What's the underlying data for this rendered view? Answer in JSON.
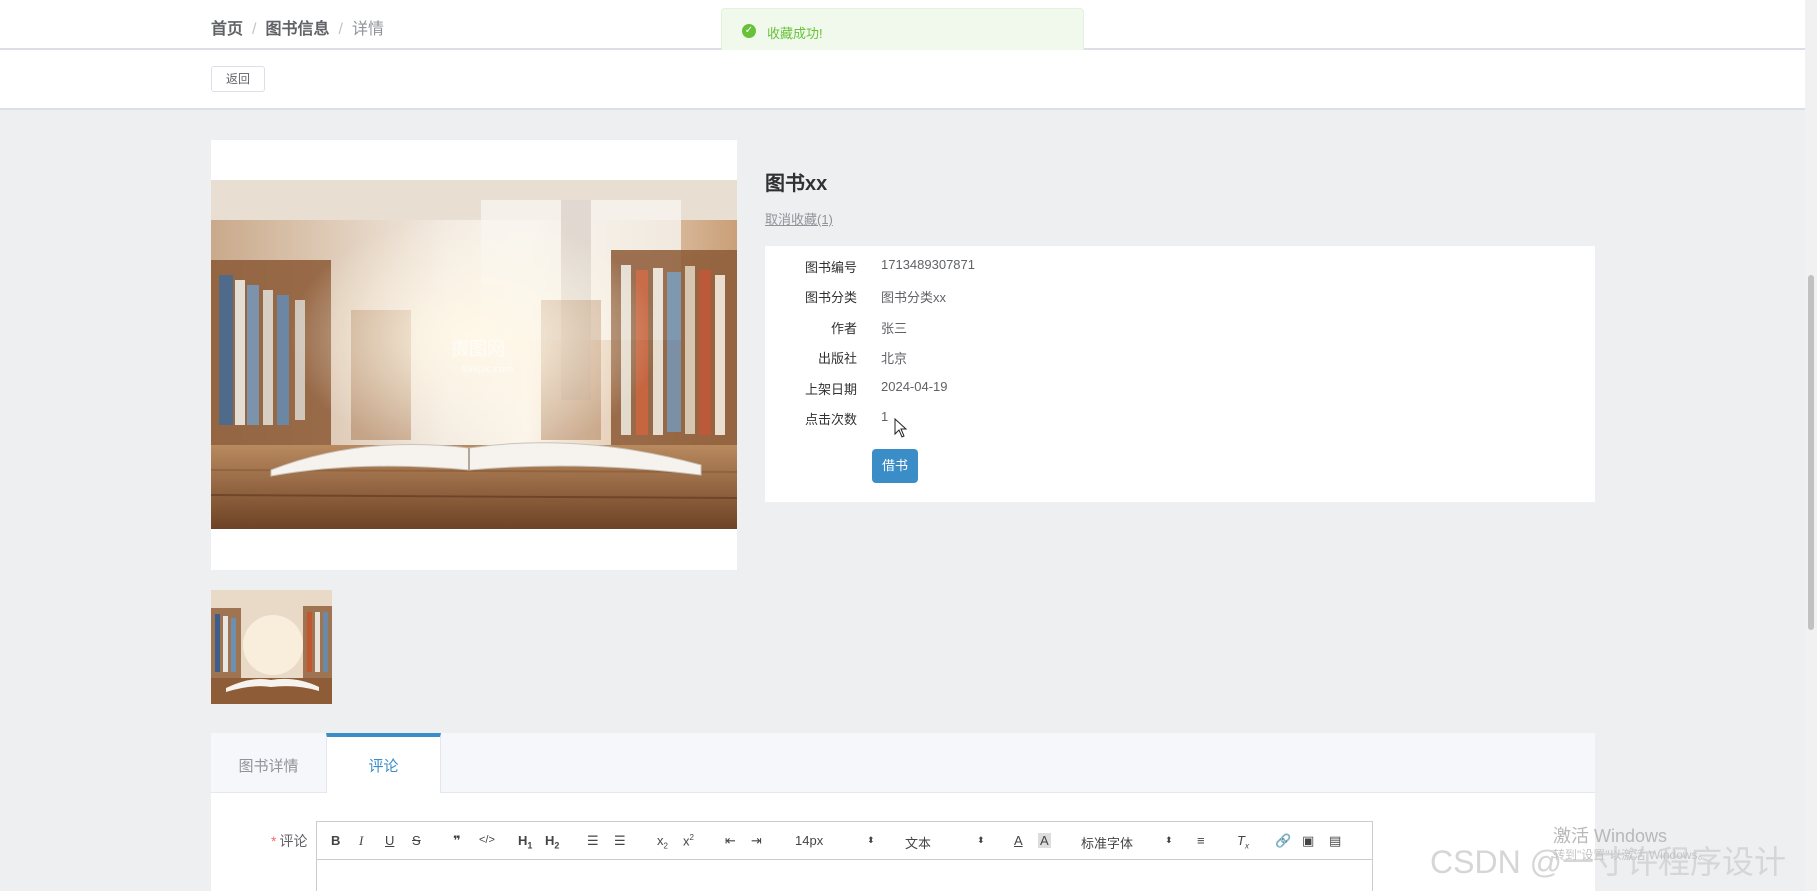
{
  "breadcrumb": {
    "home": "首页",
    "list": "图书信息",
    "current": "详情",
    "separator": "/"
  },
  "toast": {
    "text": "收藏成功!",
    "icon": "check-circle-icon",
    "color": "#67c23a"
  },
  "actions": {
    "back_label": "返回"
  },
  "book": {
    "title": "图书xx",
    "favorite_link": "取消收藏(1)",
    "fields": [
      {
        "label": "图书编号",
        "value": "1713489307871"
      },
      {
        "label": "图书分类",
        "value": "图书分类xx"
      },
      {
        "label": "作者",
        "value": "张三"
      },
      {
        "label": "出版社",
        "value": "北京"
      },
      {
        "label": "上架日期",
        "value": "2024-04-19"
      },
      {
        "label": "点击次数",
        "value": "1"
      }
    ],
    "borrow_label": "借书",
    "image_watermark": {
      "brand": "摄图网",
      "domain": "699pic.com"
    }
  },
  "tabs": [
    {
      "label": "图书详情",
      "active": false
    },
    {
      "label": "评论",
      "active": true
    }
  ],
  "comment_form": {
    "label": "评论",
    "required_mark": "*",
    "toolbar": {
      "font_size": "14px",
      "header_type": "文本",
      "font_family": "标准字体"
    }
  },
  "watermarks": {
    "windows_title": "激活 Windows",
    "windows_sub": "转到\"设置\"以激活 Windows。",
    "csdn": "CSDN @一寸许程序设计"
  },
  "colors": {
    "primary": "#3b8dc8",
    "success": "#67c23a",
    "background": "#eeeff1"
  }
}
